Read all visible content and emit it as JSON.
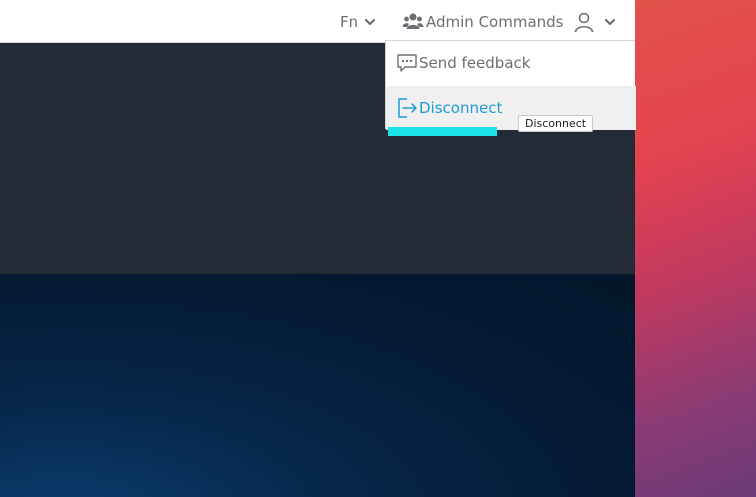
{
  "topbar": {
    "fn_label": "Fn",
    "admin_label": "Admin Commands",
    "icons": {
      "fn_chevron": "chevron-down-icon",
      "admin": "users-icon",
      "user": "user-icon",
      "user_chevron": "chevron-down-icon"
    }
  },
  "menu": {
    "items": [
      {
        "label": "Send feedback",
        "icon": "feedback-icon"
      },
      {
        "label": "Disconnect",
        "icon": "sign-out-icon"
      }
    ]
  },
  "tooltip": {
    "text": "Disconnect"
  },
  "colors": {
    "accent": "#1f9ad6",
    "highlight": "#19e3e8",
    "topbar_text": "#6a6f75",
    "dark_panel": "#222b36"
  }
}
